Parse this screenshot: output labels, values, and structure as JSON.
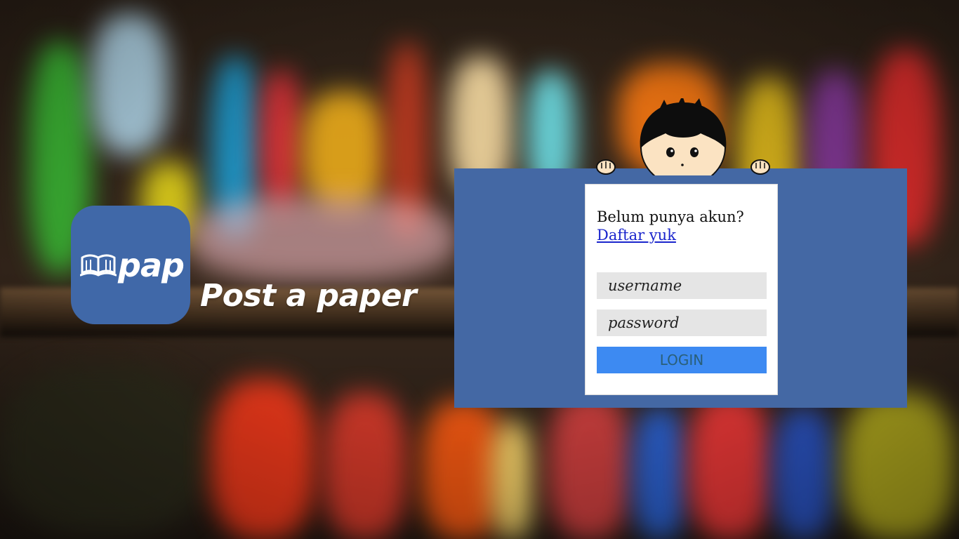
{
  "brand": {
    "logo_text": "pap",
    "tagline": "Post a paper",
    "tile_color": "#4068a8"
  },
  "login": {
    "prompt": "Belum punya akun?",
    "signup_link": "Daftar yuk",
    "username_placeholder": "username",
    "password_placeholder": "password",
    "login_button": "LOGIN",
    "panel_color": "#4468a4",
    "button_color": "#3d8af2"
  },
  "icons": {
    "logo_book": "open-book-icon",
    "mascot": "peeking-boy-mascot"
  }
}
